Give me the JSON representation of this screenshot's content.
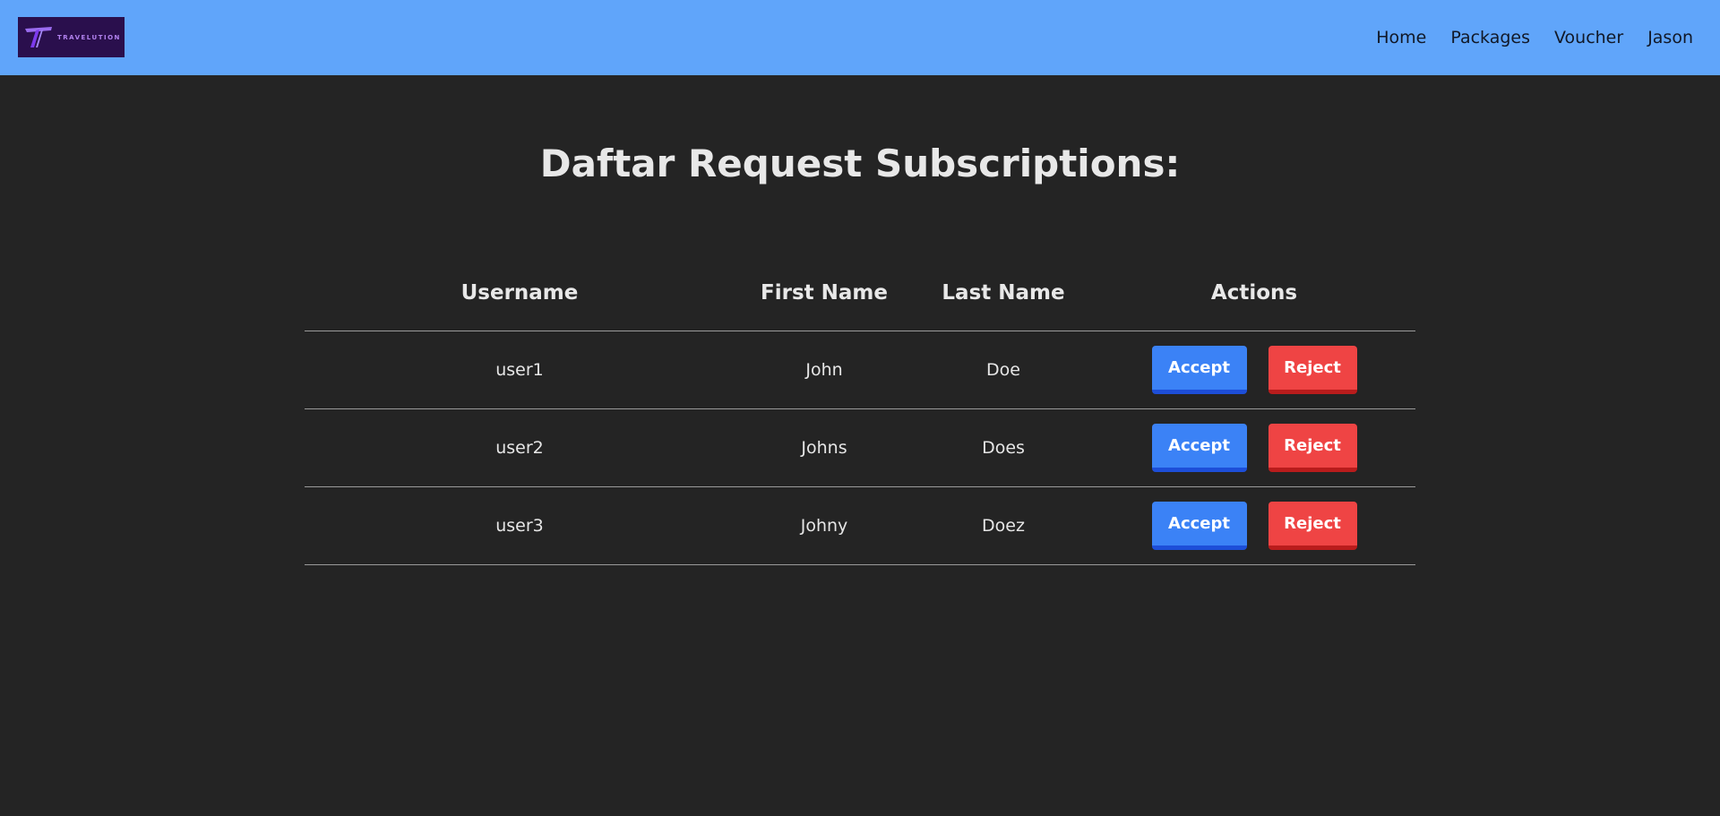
{
  "brand": {
    "name": "TRAVELUTION"
  },
  "nav": {
    "links": [
      "Home",
      "Packages",
      "Voucher",
      "Jason"
    ]
  },
  "page": {
    "title": "Daftar Request Subscriptions:"
  },
  "table": {
    "headers": {
      "username": "Username",
      "first_name": "First Name",
      "last_name": "Last Name",
      "actions": "Actions"
    },
    "rows": [
      {
        "username": "user1",
        "first_name": "John",
        "last_name": "Doe"
      },
      {
        "username": "user2",
        "first_name": "Johns",
        "last_name": "Does"
      },
      {
        "username": "user3",
        "first_name": "Johny",
        "last_name": "Doez"
      }
    ],
    "accept_label": "Accept",
    "reject_label": "Reject"
  },
  "colors": {
    "navbar": "#60a5fa",
    "background": "#242424",
    "accept": "#3b82f6",
    "reject": "#ef4444",
    "logo_bg": "#2a0f4d"
  }
}
